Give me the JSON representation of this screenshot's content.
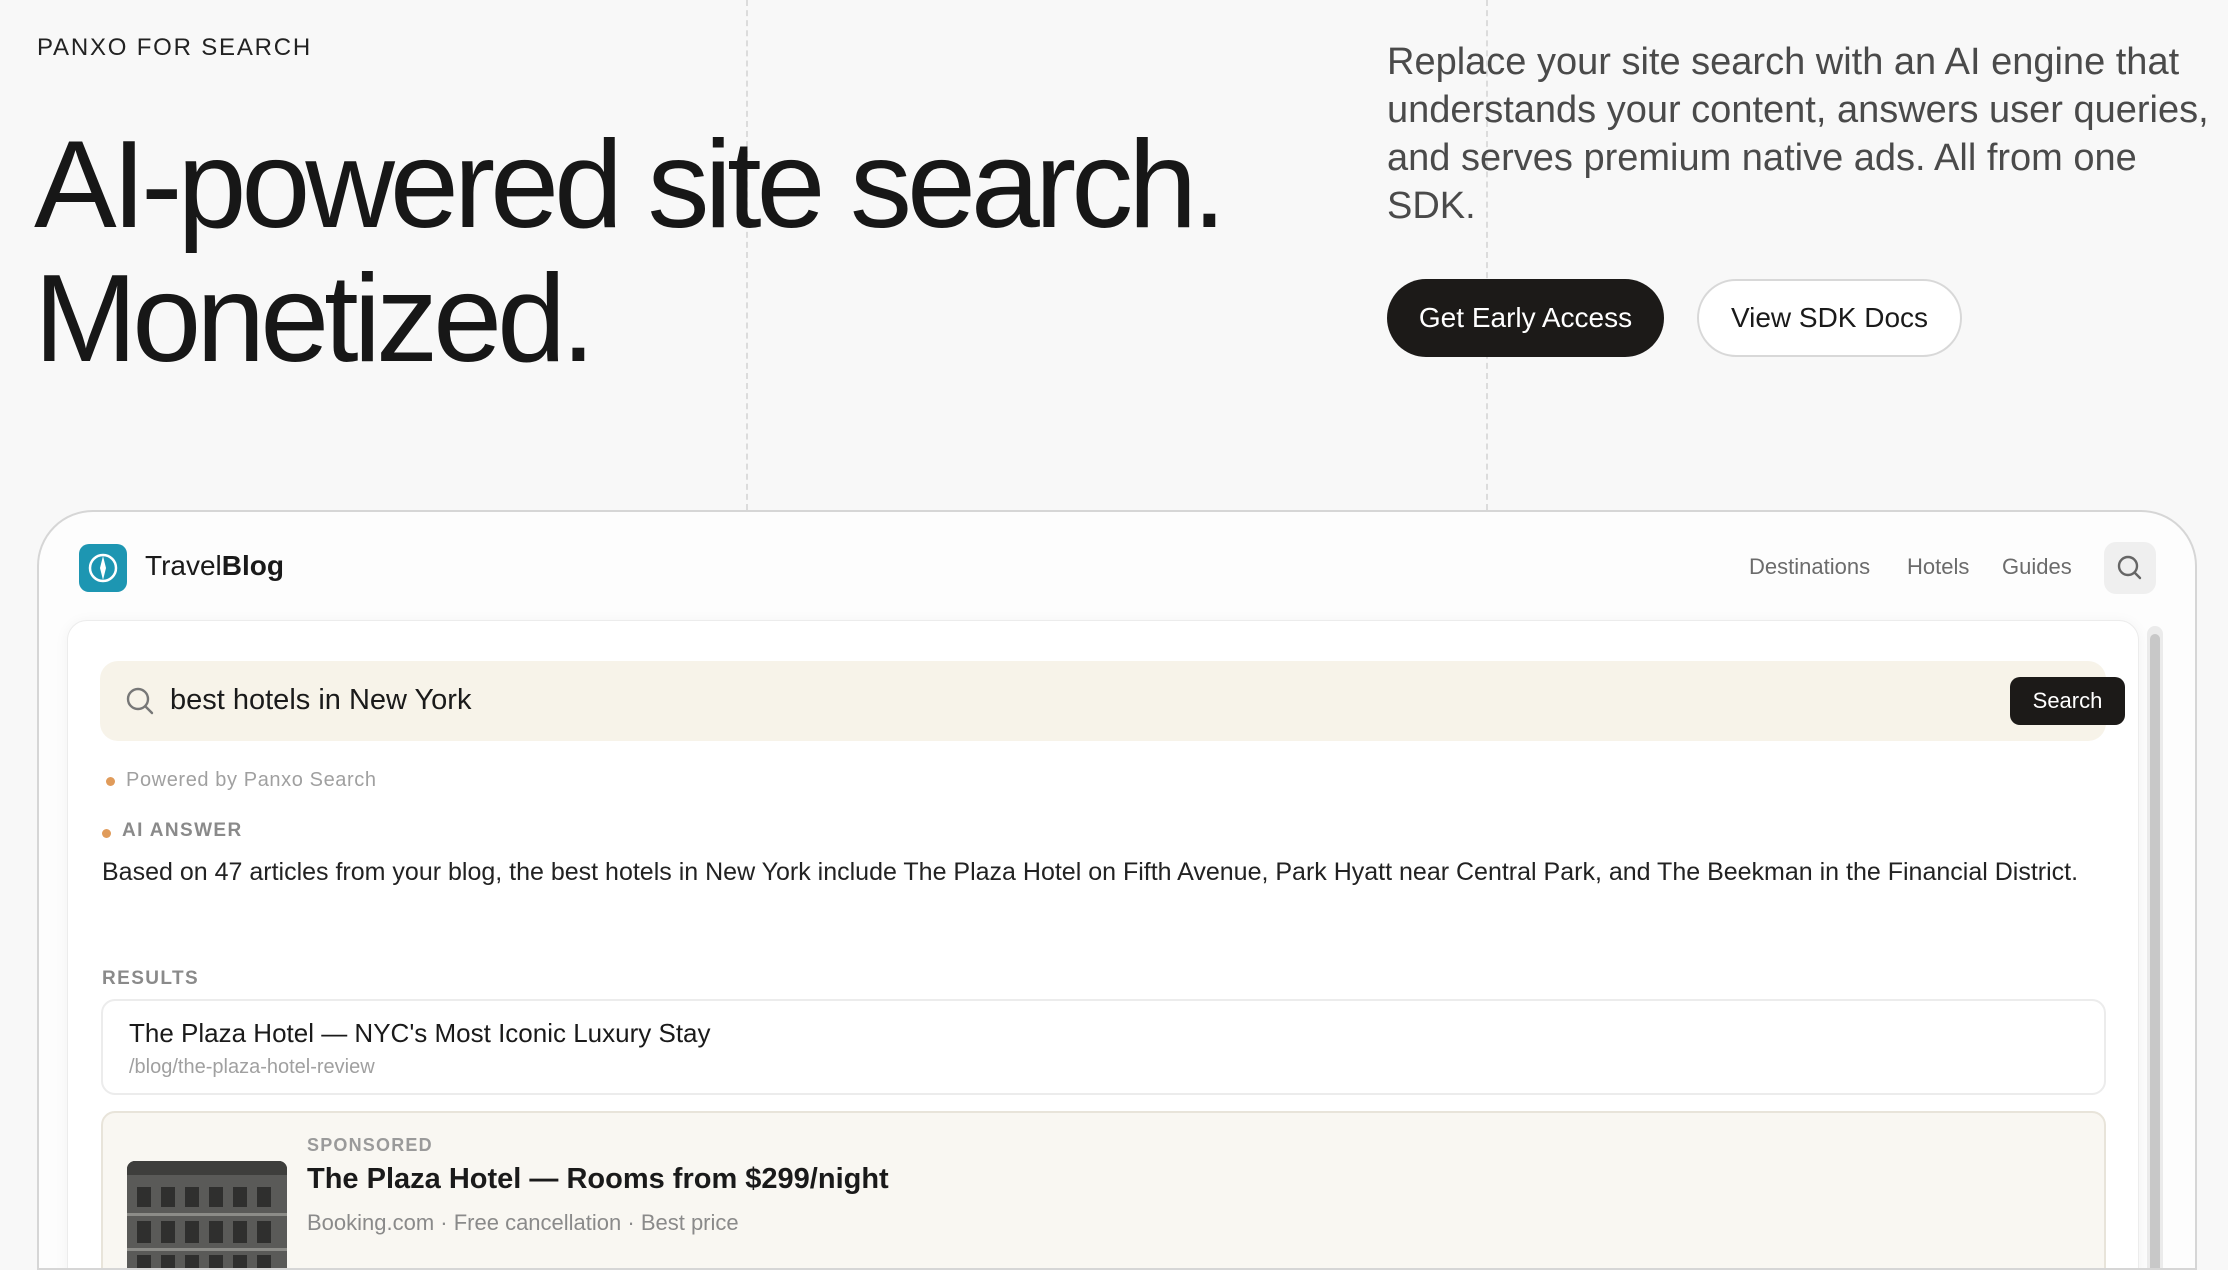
{
  "hero": {
    "eyebrow": "PANXO FOR SEARCH",
    "headline_line1": "AI-powered site search.",
    "headline_line2": "Monetized.",
    "subcopy": "Replace your site search with an AI engine that understands your content, answers user queries, and serves premium native ads. All from one SDK.",
    "cta_primary": "Get Early Access",
    "cta_secondary": "View SDK Docs"
  },
  "demo_site": {
    "brand_regular": "Travel",
    "brand_bold": "Blog",
    "logo_color": "#1d96b2",
    "nav_items": [
      "Destinations",
      "Hotels",
      "Guides"
    ],
    "search": {
      "query": "best hotels in New York",
      "button_label": "Search"
    },
    "powered_by": "Powered by Panxo Search",
    "ai_answer": {
      "label": "AI ANSWER",
      "text": "Based on 47 articles from your blog, the best hotels in New York include The Plaza Hotel on Fifth Avenue, Park Hyatt near Central Park, and The Beekman in the Financial District."
    },
    "results_label": "RESULTS",
    "results": [
      {
        "title": "The Plaza Hotel — NYC's Most Iconic Luxury Stay",
        "url": "/blog/the-plaza-hotel-review"
      }
    ],
    "sponsored": {
      "label": "SPONSORED",
      "title": "The Plaza Hotel — Rooms from $299/night",
      "meta": "Booking.com · Free cancellation · Best price"
    }
  },
  "colors": {
    "accent_dot": "#e09b5a",
    "dark_button": "#1c1a18",
    "search_bar_bg": "#f7f3e9",
    "page_bg": "#f8f8f8"
  }
}
